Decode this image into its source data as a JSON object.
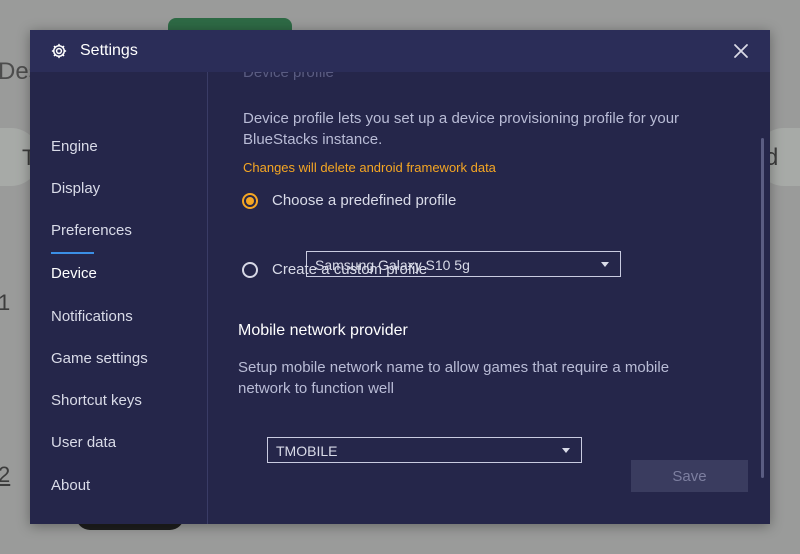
{
  "background": {
    "text_des": "Des",
    "chip_left_text": "T",
    "chip_right_text": "d",
    "num1": "1",
    "num2": "2"
  },
  "dialog": {
    "title": "Settings",
    "close_glyph": "×"
  },
  "sidebar": {
    "items": [
      {
        "label": "Engine"
      },
      {
        "label": "Display"
      },
      {
        "label": "Preferences"
      },
      {
        "label": "Device",
        "active": true
      },
      {
        "label": "Notifications"
      },
      {
        "label": "Game settings"
      },
      {
        "label": "Shortcut keys"
      },
      {
        "label": "User data"
      },
      {
        "label": "About"
      }
    ]
  },
  "device": {
    "section_title": "Device profile",
    "description": "Device profile lets you set up a device provisioning profile for your BlueStacks instance.",
    "warning": "Changes will delete android framework data",
    "options": {
      "predefined": {
        "label": "Choose a predefined profile",
        "checked": true
      },
      "custom": {
        "label": "Create a custom profile",
        "checked": false
      }
    },
    "profile_select_value": "Samsung Galaxy S10 5g"
  },
  "network": {
    "heading": "Mobile network provider",
    "description": "Setup mobile network name to allow games that require a mobile network to function well",
    "select_value": "TMOBILE"
  },
  "footer": {
    "save_label": "Save"
  },
  "colors": {
    "dialog_bg": "#25264a",
    "titlebar_bg": "#2b2d58",
    "accent_orange": "#f5a623",
    "active_underline": "#3b8fe6"
  }
}
